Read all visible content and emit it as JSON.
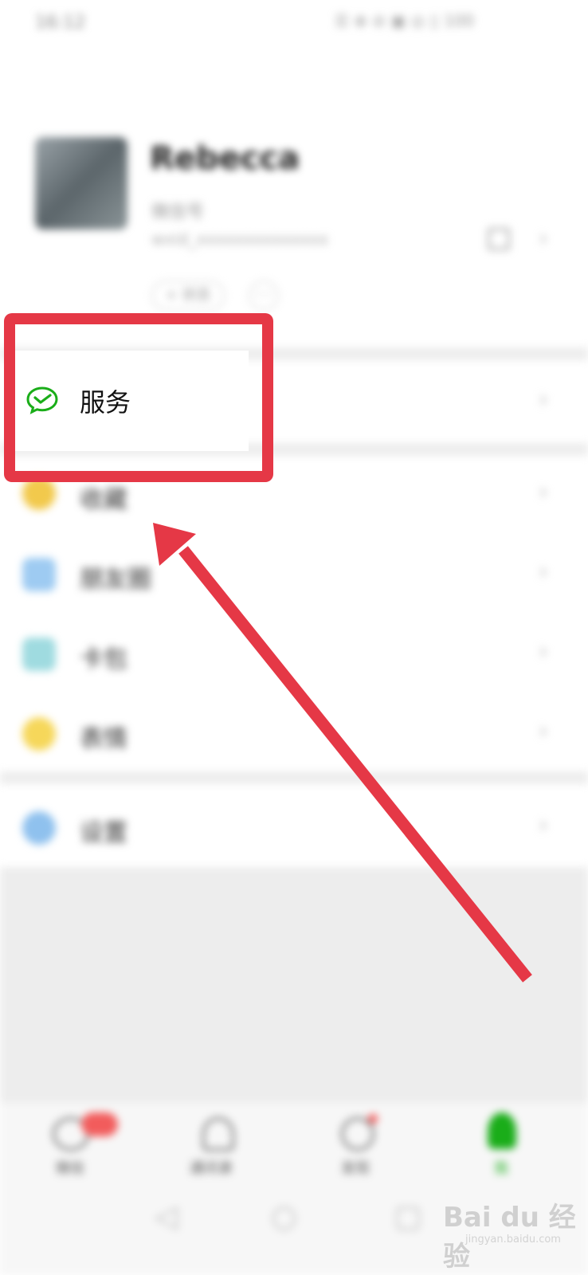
{
  "status_bar": {
    "time": "16:12",
    "indicators": "☰ ⊕ ⊘ ▣ ◎ ▯ 100"
  },
  "profile": {
    "name": "Rebecca",
    "line1": "微信号",
    "wechat_id": "wxid_xxxxxxxxxxxxxx",
    "status_label": "+ 状态"
  },
  "menu": {
    "service": {
      "label": "服务",
      "icon": "wechat-pay-icon",
      "color": "#1aad19"
    },
    "items": [
      {
        "label": "收藏",
        "icon": "favorites-icon",
        "color": "#f2c94c"
      },
      {
        "label": "朋友圈",
        "icon": "moments-icon",
        "color": "#9ecbf2"
      },
      {
        "label": "卡包",
        "icon": "cards-icon",
        "color": "#9fdbe0"
      },
      {
        "label": "表情",
        "icon": "stickers-icon",
        "color": "#f6d75a"
      }
    ],
    "settings": {
      "label": "设置",
      "icon": "settings-icon",
      "color": "#8fc1ee"
    }
  },
  "tabs": [
    {
      "label": "微信",
      "icon": "chat-icon",
      "badge_color": "#f25c5c"
    },
    {
      "label": "通讯录",
      "icon": "contacts-icon"
    },
    {
      "label": "发现",
      "icon": "discover-icon"
    },
    {
      "label": "我",
      "icon": "me-icon",
      "active_color": "#1aad19"
    }
  ],
  "annotation": {
    "color": "#e53846"
  },
  "watermark": {
    "brand": "Bai du 经验",
    "url": "jingyan.baidu.com"
  }
}
